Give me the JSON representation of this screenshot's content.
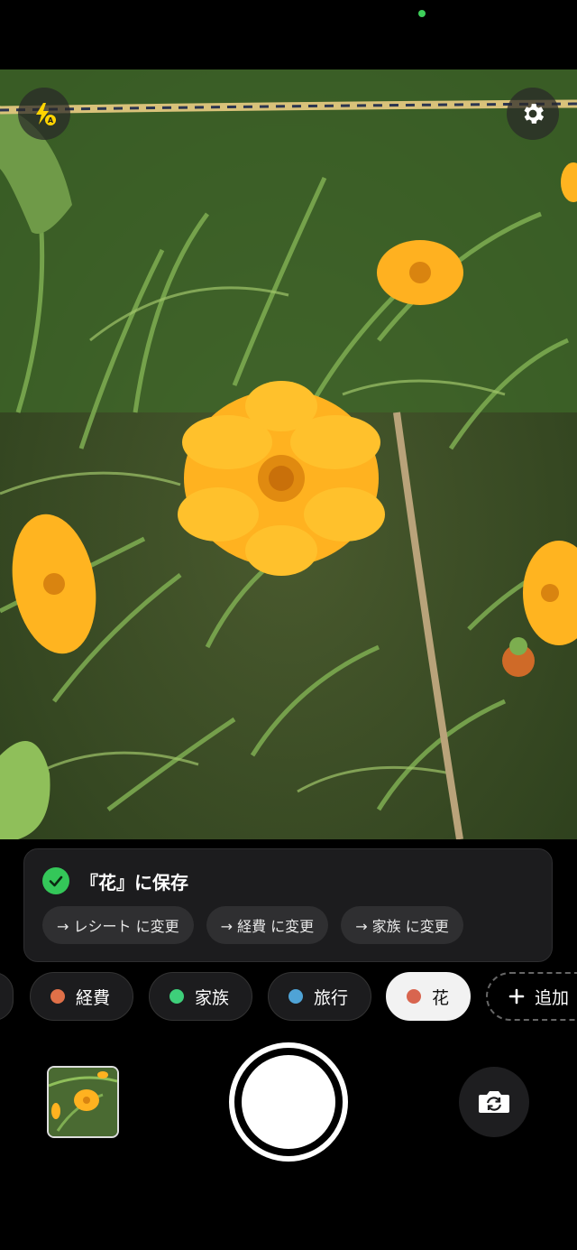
{
  "top_controls": {
    "flash_icon": "flash-auto-icon",
    "settings_icon": "gear-icon"
  },
  "toast": {
    "title": "『花』に保存",
    "status_color": "#34c759",
    "actions": [
      {
        "label": "→ レシート に変更"
      },
      {
        "label": "→ 経費 に変更"
      },
      {
        "label": "→ 家族 に変更"
      }
    ]
  },
  "albums": [
    {
      "label": "経費",
      "color": "#e07048"
    },
    {
      "label": "家族",
      "color": "#3ecf7a"
    },
    {
      "label": "旅行",
      "color": "#4fa3d6"
    },
    {
      "label": "花",
      "color": "#d8654f",
      "selected": true
    }
  ],
  "add_album": {
    "label": "追加"
  },
  "accent": "#34c759"
}
